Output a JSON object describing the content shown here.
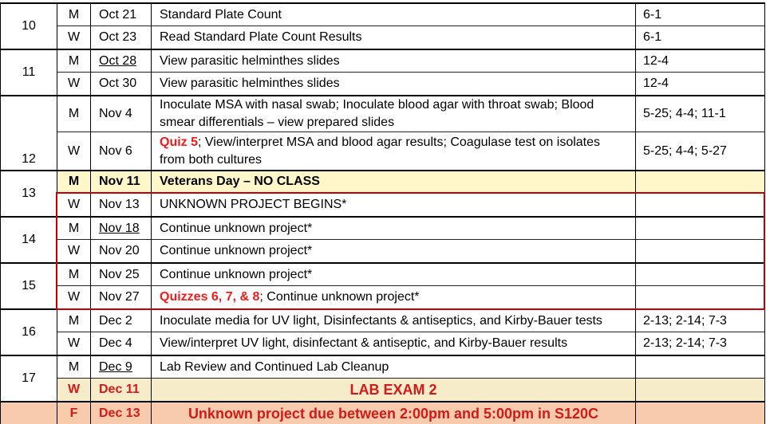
{
  "colors": {
    "grid_line": "#000000",
    "holiday_row_bg": "#fff6c9",
    "exam_row_bg": "#f7ecca",
    "due_row_bg": "#f8cbad",
    "quiz_text": "#ee1c1c",
    "exam_text": "#d11a1a",
    "highlight_box": "#c00000"
  },
  "schedule": {
    "weeks": [
      {
        "week": "10",
        "sessions": [
          {
            "day": "M",
            "date": "Oct 21",
            "activity": "Standard Plate Count",
            "reference": "6-1"
          },
          {
            "day": "W",
            "date": "Oct 23",
            "activity": "Read Standard Plate Count Results",
            "reference": "6-1"
          }
        ]
      },
      {
        "week": "11",
        "sessions": [
          {
            "day": "M",
            "date": "Oct 28",
            "activity": "View parasitic helminthes slides",
            "reference": "12-4"
          },
          {
            "day": "W",
            "date": "Oct 30",
            "activity": "View parasitic helminthes slides",
            "reference": "12-4"
          }
        ]
      },
      {
        "week": "12",
        "sessions": [
          {
            "day": "M",
            "date": "Nov 4",
            "activity": "Inoculate MSA with nasal swab; Inoculate blood agar with throat swab; Blood smear differentials – view prepared slides",
            "reference": "5-25; 4-4; 11-1"
          },
          {
            "day": "W",
            "date": "Nov 6",
            "activity_highlight": "Quiz 5",
            "activity": "; View/interpret MSA and blood agar results; Coagulase test on isolates from both cultures",
            "reference": "5-25; 4-4; 5-27"
          }
        ]
      },
      {
        "week": "13",
        "sessions": [
          {
            "day": "M",
            "date": "Nov 11",
            "activity": "Veterans Day – NO CLASS"
          },
          {
            "day": "W",
            "date": "Nov 13",
            "activity": "UNKNOWN PROJECT BEGINS*"
          }
        ]
      },
      {
        "week": "14",
        "sessions": [
          {
            "day": "M",
            "date": "Nov 18",
            "activity": "Continue unknown project*"
          },
          {
            "day": "W",
            "date": "Nov 20",
            "activity": "Continue unknown project*"
          }
        ]
      },
      {
        "week": "15",
        "sessions": [
          {
            "day": "M",
            "date": "Nov 25",
            "activity": "Continue unknown project*"
          },
          {
            "day": "W",
            "date": "Nov 27",
            "activity_highlight": "Quizzes 6, 7, & 8",
            "activity": "; Continue unknown project*"
          }
        ]
      },
      {
        "week": "16",
        "sessions": [
          {
            "day": "M",
            "date": "Dec 2",
            "activity": "Inoculate media for UV light, Disinfectants & antiseptics, and Kirby-Bauer tests",
            "reference": "2-13; 2-14; 7-3"
          },
          {
            "day": "W",
            "date": "Dec 4",
            "activity": "View/interpret UV light, disinfectant & antiseptic, and Kirby-Bauer results",
            "reference": "2-13; 2-14; 7-3"
          }
        ]
      },
      {
        "week": "17",
        "sessions": [
          {
            "day": "M",
            "date": "Dec 9",
            "activity": "Lab Review and Continued Lab Cleanup"
          },
          {
            "day": "W",
            "date": "Dec 11",
            "activity": "LAB EXAM 2"
          }
        ]
      }
    ],
    "final_session": {
      "day": "F",
      "date": "Dec 13",
      "activity": "Unknown project due between 2:00pm and 5:00pm in S120C"
    }
  }
}
